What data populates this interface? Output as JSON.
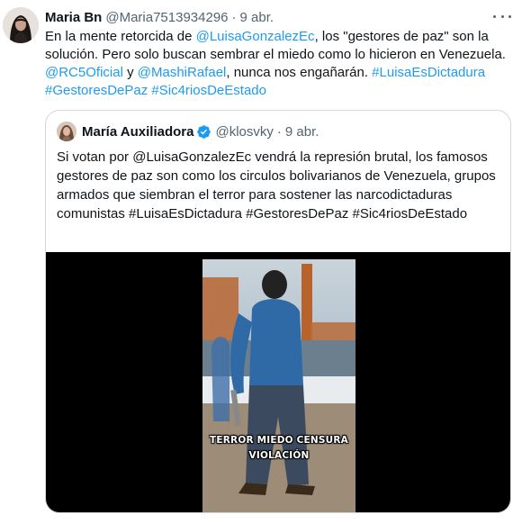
{
  "tweet": {
    "author_name": "Maria Bn",
    "author_handle": "@Maria7513934296",
    "separator": "·",
    "date": "9 abr.",
    "text_segments": [
      {
        "text": "En la mente retorcida de ",
        "link": false
      },
      {
        "text": "@LuisaGonzalezEc",
        "link": true
      },
      {
        "text": ", los \"gestores de paz\" son la solución. Pero solo buscan sembrar el miedo como lo hicieron en Venezuela. ",
        "link": false
      },
      {
        "text": "@RC5Oficial",
        "link": true
      },
      {
        "text": " y ",
        "link": false
      },
      {
        "text": "@MashiRafael",
        "link": true
      },
      {
        "text": ", nunca nos engañarán. ",
        "link": false
      },
      {
        "text": "#LuisaEsDictadura",
        "link": true
      },
      {
        "text": " ",
        "link": false
      },
      {
        "text": "#GestoresDePaz",
        "link": true
      },
      {
        "text": " ",
        "link": false
      },
      {
        "text": "#Sic4riosDeEstado",
        "link": true
      }
    ],
    "more_icon": "more-horizontal-icon"
  },
  "quoted_tweet": {
    "author_name": "María Auxiliadora",
    "author_handle": "@klosvky",
    "separator": "·",
    "date": "9 abr.",
    "verified_icon": "verified-badge-icon",
    "text": "Si votan por @LuisaGonzalezEc vendrá la represión brutal, los famosos gestores de paz son como los circulos bolivarianos de Venezuela, grupos armados que siembran el terror para sostener las narcodictaduras comunistas #LuisaEsDictadura #GestoresDePaz #Sic4riosDeEstado",
    "video_caption_line1": "TERROR MIEDO CENSURA",
    "video_caption_line2": "VIOLACIÓN"
  },
  "colors": {
    "link": "#1d9bf0",
    "secondary_text": "#536471",
    "border": "#cfd9de",
    "verified": "#1d9bf0"
  }
}
